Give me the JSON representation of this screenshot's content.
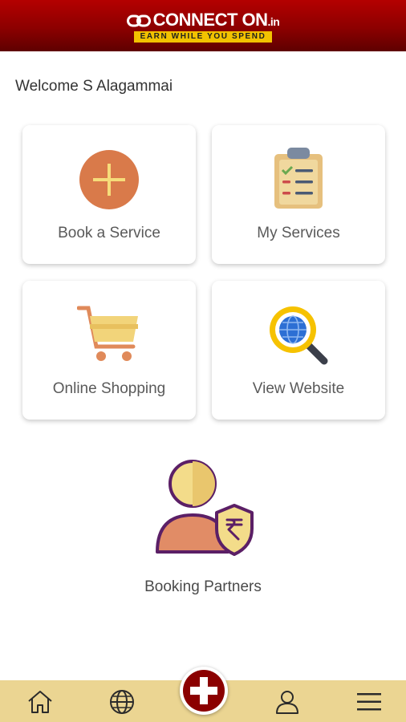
{
  "header": {
    "brand": "CONNECT ON",
    "brand_suffix": ".in",
    "tagline": "EARN WHILE YOU SPEND",
    "colors": {
      "bar": "#9a0000",
      "tagline_bg": "#f2c200"
    }
  },
  "welcome_text": "Welcome S Alagammai",
  "tiles": [
    {
      "label": "Book a Service",
      "icon": "plus-circle-icon"
    },
    {
      "label": "My Services",
      "icon": "clipboard-checklist-icon"
    },
    {
      "label": "Online Shopping",
      "icon": "shopping-cart-icon"
    },
    {
      "label": "View Website",
      "icon": "globe-magnifier-icon"
    }
  ],
  "partners": {
    "label": "Booking Partners",
    "icon": "person-rupee-shield-icon"
  },
  "bottom_nav": {
    "items": [
      "home-icon",
      "globe-icon",
      "add-icon",
      "user-icon",
      "menu-icon"
    ],
    "bar_color": "#ebd592",
    "accent": "#8b0000"
  }
}
